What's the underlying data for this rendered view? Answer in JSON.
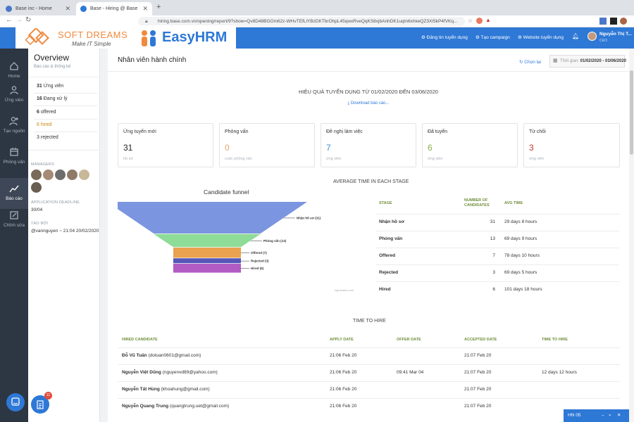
{
  "browser": {
    "tabs": [
      {
        "title": "Base inc - Home"
      },
      {
        "title": "Base - Hiring @ Base"
      }
    ],
    "url": "hiring.base.com.vn/opening/report/9?show=Qv8D48BGOm62z-WHvTEfLlYBzDKTbrOhpL45qwxRveQqKS8xjbAnhDK1uqtn6xhkeQZ3XI5kP4fVKq..."
  },
  "logo": {
    "softdreams_name": "SOFT DREAMS",
    "softdreams_tagline": "Make IT Simple",
    "easyhrm_name": "EasyHRM"
  },
  "header": {
    "links": [
      "Đăng tin tuyển dụng",
      "Tạo campaign",
      "Website tuyển dụng"
    ],
    "user_name": "Nguyễn Thị T...",
    "user_role": "CEO"
  },
  "nav": {
    "items": [
      {
        "label": "Home",
        "icon": "home-icon"
      },
      {
        "label": "Ứng viên",
        "icon": "user-icon"
      },
      {
        "label": "Tạo nguồn",
        "icon": "add-user-icon"
      },
      {
        "label": "Phỏng vấn",
        "icon": "calendar-icon"
      },
      {
        "label": "Báo cáo",
        "icon": "chart-line-icon"
      },
      {
        "label": "Chỉnh sửa",
        "icon": "edit-icon"
      }
    ],
    "badge": "11"
  },
  "overview": {
    "title": "Overview",
    "subtitle": "Báo cáo & thống kê",
    "stats": [
      {
        "count": "31",
        "label": "Ứng viên"
      },
      {
        "count": "16",
        "label": "Đang xử lý"
      },
      {
        "count": "6",
        "label": "offered"
      },
      {
        "count": "6",
        "label": "hired"
      },
      {
        "count": "3",
        "label": "rejected"
      }
    ],
    "managers_label": "MANAGERS",
    "deadline_label": "APPLICATION DEADLINE",
    "deadline": "30/04",
    "created_label": "TẠO BỞI",
    "created_by": "@vannguyen ~ 21:04 20/02/2020"
  },
  "main": {
    "title": "Nhân viên hành chính",
    "choose_label": "Chọn lại",
    "time_label": "Thời gian:",
    "time_range": "01/02/2020 - 03/06/2020",
    "report_title": "HIỆU QUẢ TUYỂN DỤNG TỪ 01/02/2020 ĐẾN 03/06/2020",
    "download_label": "Download báo cáo...",
    "cards": [
      {
        "label": "Ứng tuyển mới",
        "value": "31",
        "sub": "hồ sơ",
        "color": "#222222"
      },
      {
        "label": "Phỏng vấn",
        "value": "0",
        "sub": "cuộc phỏng vấn",
        "color": "#e8a56a"
      },
      {
        "label": "Đề nghị làm việc",
        "value": "7",
        "sub": "ứng viên",
        "color": "#3f8fd6"
      },
      {
        "label": "Đã tuyển",
        "value": "6",
        "sub": "ứng viên",
        "color": "#88b04b"
      },
      {
        "label": "Từ chối",
        "value": "3",
        "sub": "ứng viên",
        "color": "#c0392b"
      }
    ],
    "avg_title": "AVERAGE TIME IN EACH STAGE",
    "avg_headers": [
      "STAGE",
      "NUMBER OF CANDIDATES",
      "AVG TIME"
    ],
    "avg_rows": [
      {
        "stage": "Nhận hồ sơ",
        "count": "31",
        "time": "29 days 8 hours"
      },
      {
        "stage": "Phỏng vấn",
        "count": "13",
        "time": "69 days 9 hours"
      },
      {
        "stage": "Offered",
        "count": "7",
        "time": "78 days 10 hours"
      },
      {
        "stage": "Rejected",
        "count": "3",
        "time": "69 days 5 hours"
      },
      {
        "stage": "Hired",
        "count": "6",
        "time": "101 days 18 hours"
      }
    ],
    "hire_title": "TIME TO HIRE",
    "hire_headers": [
      "HIRED CANDIDATE",
      "APPLY DATE",
      "OFFER DATE",
      "ACCEPTED DATE",
      "TIME TO HIRE"
    ],
    "hire_rows": [
      {
        "name": "Đỗ Vũ Tuấn",
        "email": "(dotuan0601@gmail.com)",
        "apply": "21:06 Feb 20",
        "offer": "",
        "accepted": "21:07 Feb 20",
        "tth": ""
      },
      {
        "name": "Nguyễn Việt Dũng",
        "email": "(nguyenvd89@yahoo.com)",
        "apply": "21:06 Feb 20",
        "offer": "09:41 Mar 04",
        "accepted": "21:07 Feb 20",
        "tth": "12 days 12 hours"
      },
      {
        "name": "Nguyễn Tất Hùng",
        "email": "(khoahung@gmail.com)",
        "apply": "21:06 Feb 20",
        "offer": "",
        "accepted": "21:07 Feb 20",
        "tth": ""
      },
      {
        "name": "Nguyễn Quang Trung",
        "email": "(quangtrung.uet@gmail.com)",
        "apply": "21:06 Feb 20",
        "offer": "",
        "accepted": "21:07 Feb 20",
        "tth": ""
      }
    ],
    "chat_label": "HN 05",
    "watermark": "highcharts.com"
  },
  "chart_data": {
    "type": "funnel",
    "title": "Candidate funnel",
    "categories": [
      "Nhận hồ sơ",
      "Phỏng vấn",
      "Offered",
      "Rejected",
      "Hired"
    ],
    "values": [
      31,
      13,
      7,
      3,
      6
    ],
    "labels": [
      "Nhận hồ sơ (31)",
      "Phỏng vấn (13)",
      "Offered (7)",
      "Rejected (3)",
      "Hired (6)"
    ],
    "colors": [
      "#7b95e0",
      "#8edc97",
      "#e9a24f",
      "#5656b8",
      "#b25bc3"
    ]
  }
}
